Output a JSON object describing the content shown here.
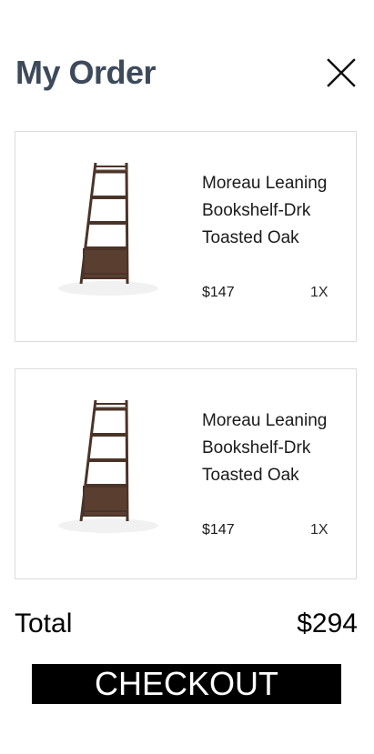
{
  "header": {
    "title": "My Order",
    "close_icon": "close-icon"
  },
  "order": {
    "items": [
      {
        "name": "Moreau Leaning Bookshelf-Drk Toasted Oak",
        "price": "$147",
        "quantity": "1X",
        "image_icon": "bookshelf-image"
      },
      {
        "name": "Moreau Leaning Bookshelf-Drk Toasted Oak",
        "price": "$147",
        "quantity": "1X",
        "image_icon": "bookshelf-image"
      }
    ]
  },
  "summary": {
    "total_label": "Total",
    "total_value": "$294"
  },
  "actions": {
    "checkout_label": "CHECKOUT"
  },
  "colors": {
    "title": "#3d4a5c",
    "card_border": "#dcdcdc",
    "button_bg": "#000000",
    "button_text": "#ffffff",
    "wood_dark": "#4a3428"
  }
}
